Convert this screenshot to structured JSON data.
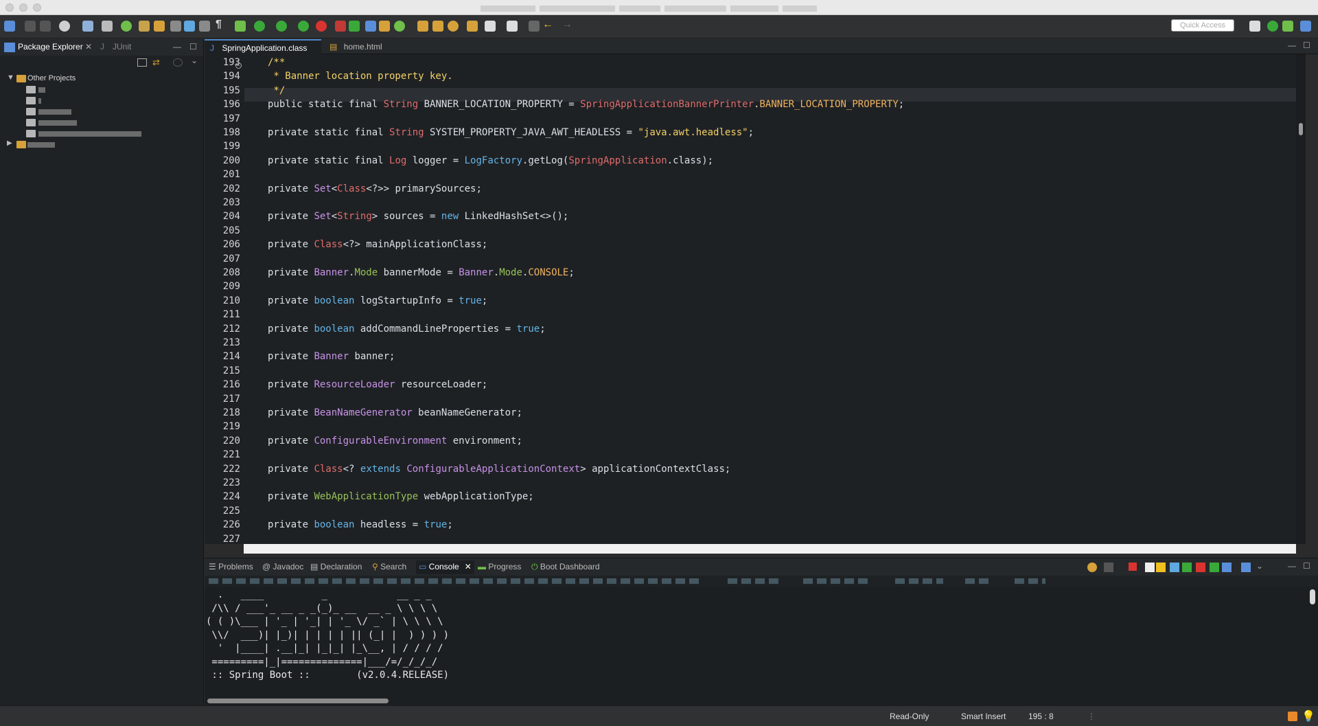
{
  "window": {
    "title": ""
  },
  "toolbar": {
    "quick_access_placeholder": "Quick Access"
  },
  "left": {
    "tabs": [
      {
        "label": "Package Explorer",
        "active": true
      },
      {
        "label": "JUnit",
        "active": false
      }
    ],
    "tree": {
      "root_label": "Other Projects"
    }
  },
  "editor": {
    "tabs": [
      {
        "label": "SpringApplication.class",
        "active": true
      },
      {
        "label": "home.html",
        "active": false
      }
    ],
    "lines": [
      {
        "n": "193",
        "text": "/**"
      },
      {
        "n": "194",
        "text": " * Banner location property key."
      },
      {
        "n": "195",
        "text": " */"
      },
      {
        "n": "196",
        "text": "public static final String BANNER_LOCATION_PROPERTY = SpringApplicationBannerPrinter.BANNER_LOCATION_PROPERTY;"
      },
      {
        "n": "197",
        "text": ""
      },
      {
        "n": "198",
        "text": "private static final String SYSTEM_PROPERTY_JAVA_AWT_HEADLESS = \"java.awt.headless\";"
      },
      {
        "n": "199",
        "text": ""
      },
      {
        "n": "200",
        "text": "private static final Log logger = LogFactory.getLog(SpringApplication.class);"
      },
      {
        "n": "201",
        "text": ""
      },
      {
        "n": "202",
        "text": "private Set<Class<?>> primarySources;"
      },
      {
        "n": "203",
        "text": ""
      },
      {
        "n": "204",
        "text": "private Set<String> sources = new LinkedHashSet<>();"
      },
      {
        "n": "205",
        "text": ""
      },
      {
        "n": "206",
        "text": "private Class<?> mainApplicationClass;"
      },
      {
        "n": "207",
        "text": ""
      },
      {
        "n": "208",
        "text": "private Banner.Mode bannerMode = Banner.Mode.CONSOLE;"
      },
      {
        "n": "209",
        "text": ""
      },
      {
        "n": "210",
        "text": "private boolean logStartupInfo = true;"
      },
      {
        "n": "211",
        "text": ""
      },
      {
        "n": "212",
        "text": "private boolean addCommandLineProperties = true;"
      },
      {
        "n": "213",
        "text": ""
      },
      {
        "n": "214",
        "text": "private Banner banner;"
      },
      {
        "n": "215",
        "text": ""
      },
      {
        "n": "216",
        "text": "private ResourceLoader resourceLoader;"
      },
      {
        "n": "217",
        "text": ""
      },
      {
        "n": "218",
        "text": "private BeanNameGenerator beanNameGenerator;"
      },
      {
        "n": "219",
        "text": ""
      },
      {
        "n": "220",
        "text": "private ConfigurableEnvironment environment;"
      },
      {
        "n": "221",
        "text": ""
      },
      {
        "n": "222",
        "text": "private Class<? extends ConfigurableApplicationContext> applicationContextClass;"
      },
      {
        "n": "223",
        "text": ""
      },
      {
        "n": "224",
        "text": "private WebApplicationType webApplicationType;"
      },
      {
        "n": "225",
        "text": ""
      },
      {
        "n": "226",
        "text": "private boolean headless = true;"
      },
      {
        "n": "227",
        "text": ""
      }
    ]
  },
  "bottom": {
    "tabs": [
      "Problems",
      "Javadoc",
      "Declaration",
      "Search",
      "Console",
      "Progress",
      "Boot Dashboard"
    ],
    "console_lines": [
      "  .   ____          _            __ _ _",
      " /\\\\ / ___'_ __ _ _(_)_ __  __ _ \\ \\ \\ \\",
      "( ( )\\___ | '_ | '_| | '_ \\/ _` | \\ \\ \\ \\",
      " \\\\/  ___)| |_)| | | | | || (_| |  ) ) ) )",
      "  '  |____| .__|_| |_|_| |_\\__, | / / / /",
      " =========|_|==============|___/=/_/_/_/",
      " :: Spring Boot ::        (v2.0.4.RELEASE)"
    ]
  },
  "status": {
    "mode": "Read-Only",
    "insert": "Smart Insert",
    "position": "195 : 8"
  },
  "colors": {
    "accent_tab": "#4a88c7",
    "keyword": "#d9e0e6",
    "type": "#e06c6c",
    "string": "#f4d266"
  }
}
